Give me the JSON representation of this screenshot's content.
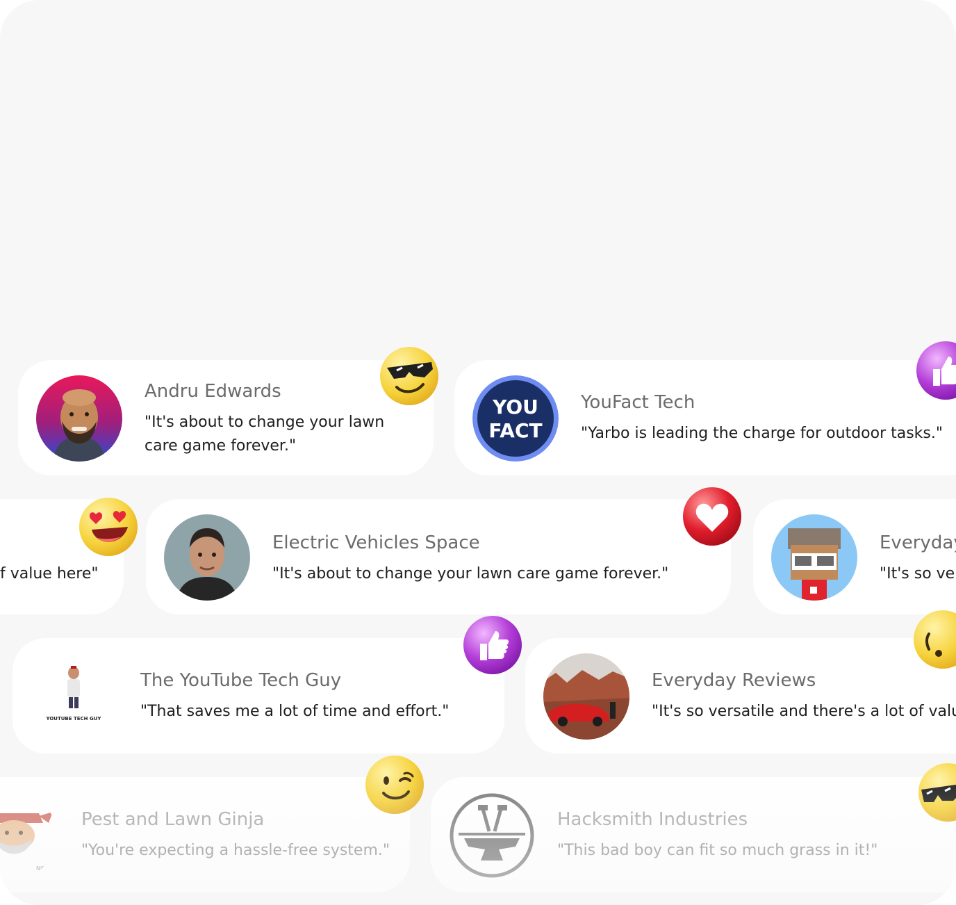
{
  "rows": [
    [
      {
        "name": "Andru Edwards",
        "quote_line1": "\"It's about to change your lawn",
        "quote_line2": "care game forever.\""
      },
      {
        "name": "YouFact Tech",
        "quote": "\"Yarbo is leading the charge for outdoor tasks.\"",
        "logo_line1": "YOU",
        "logo_line2": "FACT"
      }
    ],
    [
      {
        "name": "",
        "quote": "f value here\""
      },
      {
        "name": "Electric Vehicles Space",
        "quote": "\"It's about to change your lawn care game forever.\""
      },
      {
        "name": "Everyday",
        "quote": "\"It's so ver"
      }
    ],
    [
      {
        "name": "The YouTube Tech Guy",
        "quote": "\"That saves me a lot of time and effort.\"",
        "logo_caption": "YOUTUBE TECH GUY"
      },
      {
        "name": "Everyday Reviews",
        "quote": "\"It's so versatile and there's a lot of value"
      }
    ],
    [
      {
        "name": "Pest and Lawn Ginja",
        "quote": "\"You're expecting a hassle-free system.\"",
        "logo_caption": "NINJA"
      },
      {
        "name": "Hacksmith Industries",
        "quote": "\"This bad boy can fit so much grass in it!\""
      }
    ]
  ],
  "emojis": [
    "sunglasses-emoji",
    "thumbs-up-emoji",
    "heart-eyes-emoji",
    "heart-emoji",
    "thumbs-up-emoji",
    "wink-emoji",
    "wink-emoji",
    "sunglasses-emoji"
  ],
  "colors": {
    "background": "#f7f7f7",
    "card": "#ffffff",
    "name": "#6b6b6b",
    "quote": "#1e1e1e",
    "thumbs_purple": "#b43ed8",
    "heart_red": "#e11d2c",
    "emoji_yellow": "#f6d33c"
  }
}
